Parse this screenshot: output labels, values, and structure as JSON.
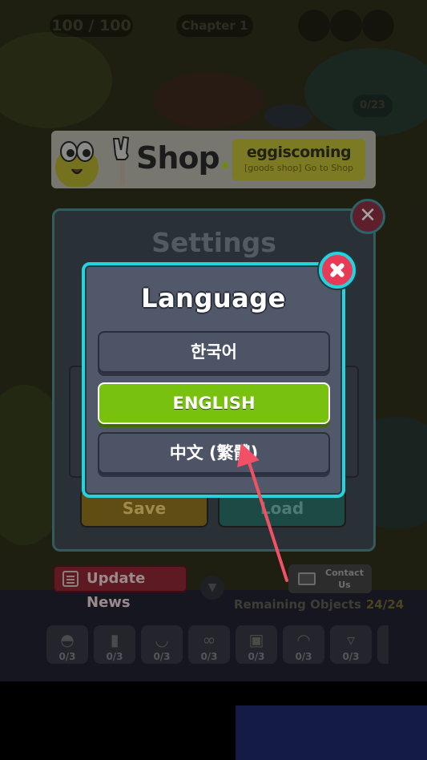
{
  "hud": {
    "score": "100 / 100",
    "chapter": "Chapter 1",
    "map_counter": "0/23"
  },
  "shop_banner": {
    "title": "Shop",
    "title_dot": ".",
    "egg_logo": "eggiscoming",
    "egg_sub": "[goods shop] Go to Shop"
  },
  "settings": {
    "title": "Settings",
    "save_label": "Save",
    "load_label": "Load"
  },
  "language_dialog": {
    "title": "Language",
    "options": [
      {
        "label": "한국어",
        "selected": false
      },
      {
        "label": "ENGLISH",
        "selected": true
      },
      {
        "label": "中文 (繁體)",
        "selected": false
      }
    ]
  },
  "bottom": {
    "update_news": "Update News",
    "contact_line1": "Contact",
    "contact_line2": "Us",
    "remaining_label": "Remaining Objects",
    "remaining_count": "24/24",
    "slots": [
      {
        "icon": "watermelon-icon",
        "count": "0/3"
      },
      {
        "icon": "bottle-icon",
        "count": "0/3"
      },
      {
        "icon": "bowl-icon",
        "count": "0/3"
      },
      {
        "icon": "goggles-icon",
        "count": "0/3"
      },
      {
        "icon": "cake-icon",
        "count": "0/3"
      },
      {
        "icon": "croissant-icon",
        "count": "0/3"
      },
      {
        "icon": "icecream-icon",
        "count": "0/3"
      }
    ]
  },
  "colors": {
    "dialog_border": "#27d2dc",
    "selected_option": "#79c10f",
    "close_button": "#e63a57",
    "arrow": "#f25064"
  }
}
